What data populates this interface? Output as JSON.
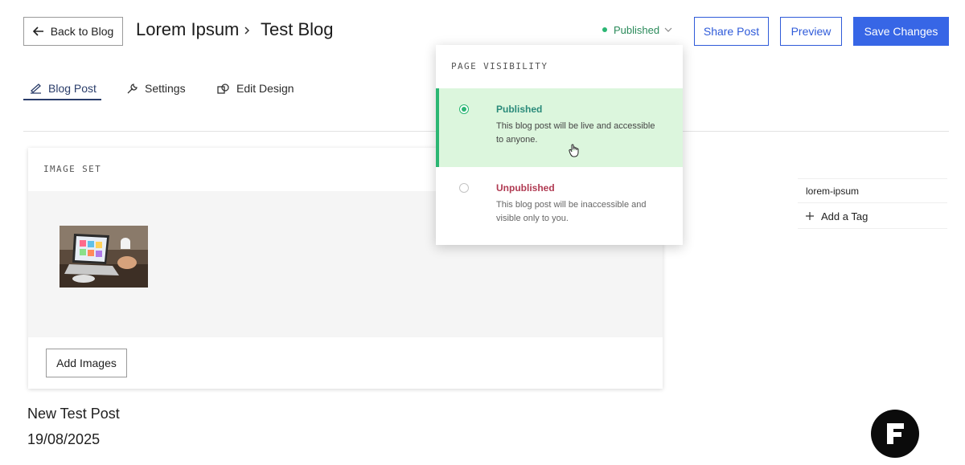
{
  "header": {
    "back_label": "Back to Blog",
    "breadcrumb_site": "Lorem Ipsum",
    "breadcrumb_page": "Test Blog",
    "status_label": "Published",
    "share_label": "Share Post",
    "preview_label": "Preview",
    "save_label": "Save Changes"
  },
  "tabs": [
    {
      "label": "Blog Post",
      "icon": "blog-post-icon",
      "active": true
    },
    {
      "label": "Settings",
      "icon": "wrench-icon",
      "active": false
    },
    {
      "label": "Edit Design",
      "icon": "design-icon",
      "active": false
    }
  ],
  "image_set": {
    "title": "IMAGE SET",
    "add_images_label": "Add Images"
  },
  "post": {
    "title": "New Test Post",
    "date": "19/08/2025"
  },
  "visibility": {
    "heading": "PAGE VISIBILITY",
    "options": [
      {
        "title": "Published",
        "desc_line1": "This blog post will be live and accessible",
        "desc_line2": "to anyone.",
        "selected": true
      },
      {
        "title": "Unpublished",
        "desc_line1": "This blog post will be inaccessible and",
        "desc_line2": "visible only to you.",
        "selected": false
      }
    ]
  },
  "tags": {
    "items": [
      "lorem-ipsum"
    ],
    "add_label": "Add a Tag"
  },
  "colors": {
    "accent_blue": "#3766e6",
    "published_green": "#2bb673",
    "published_bg": "#dcf6dd",
    "unpublished_red": "#b03a52"
  }
}
